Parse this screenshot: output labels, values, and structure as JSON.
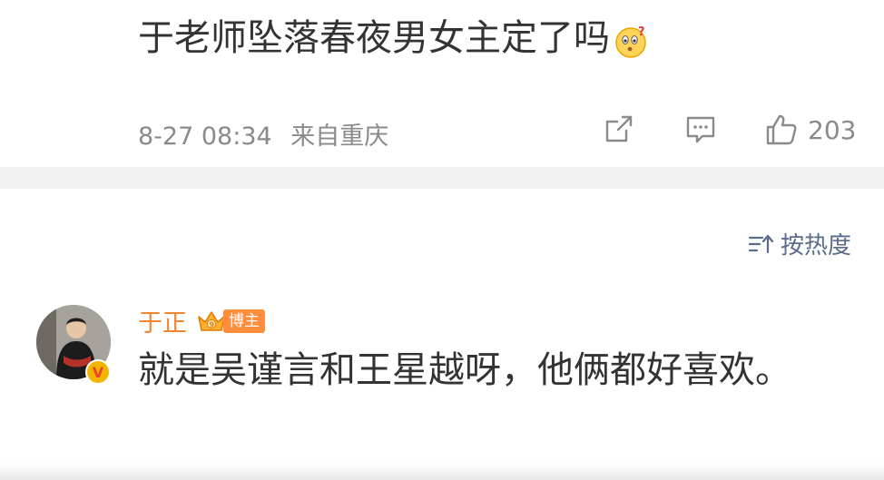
{
  "post": {
    "text": "于老师坠落春夜男女主定了吗",
    "emoji": "thinking-face-emoji",
    "date": "8-27 08:34",
    "source": "来自重庆",
    "like_count": "203"
  },
  "sort": {
    "label": "按热度"
  },
  "comment": {
    "username": "于正",
    "badge_label": "博主",
    "text": "就是吴谨言和王星越呀，他俩都好喜欢。"
  },
  "colors": {
    "username": "#f0862f",
    "sort": "#5a6c8a",
    "meta": "#8a8a8a",
    "badge": "#ff8d3a"
  }
}
